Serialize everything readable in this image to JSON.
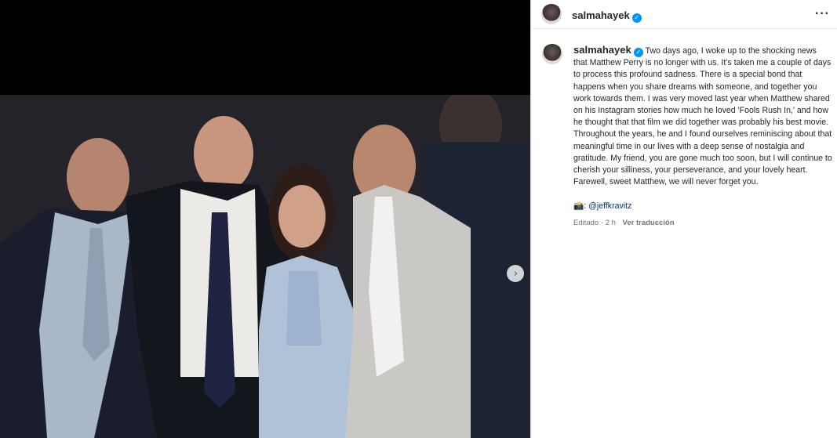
{
  "post": {
    "username": "salmahayek",
    "caption": "Two days ago, I woke up to the shocking news that Matthew Perry is no longer with us. It's taken me a couple of days to process this profound sadness. There is a special bond that happens when you share dreams with someone, and together you work towards them. I was very moved last year when Matthew shared on his Instagram stories how much he loved 'Fools Rush In,' and how he thought that that film we did together was probably his best movie. Throughout the years, he and I found ourselves reminiscing about that meaningful time in our lives with a deep sense of nostalgia and gratitude. My friend, you are gone much too soon, but I will continue to cherish your silliness, your perseverance, and your lovely heart. Farewell, sweet Matthew, we will never forget you.",
    "credit_emoji": "📸:",
    "credit_handle": "@jeffkravitz",
    "edited_label": "Editado",
    "separator": "·",
    "time_ago": "2 h",
    "translate_label": "Ver traducción",
    "more_icon": "···",
    "verified_glyph": "✓",
    "next_icon": "›"
  },
  "colors": {
    "verified": "#0095f6",
    "link": "#00376b",
    "muted": "#737373",
    "text": "#262626"
  }
}
